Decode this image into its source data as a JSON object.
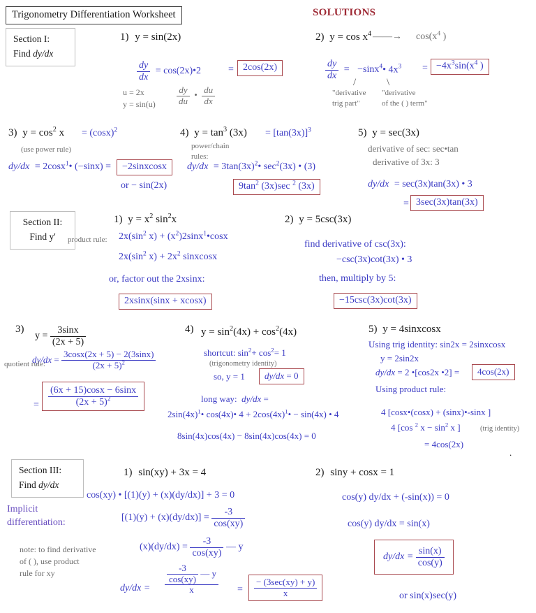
{
  "document": {
    "title": "Trigonometry Differentiation Worksheet",
    "solutions_label": "SOLUTIONS",
    "colors": {
      "work_blue": "#3b3bc4",
      "annotation_gray": "#6e6e6e",
      "answer_box_border": "#a9494f",
      "solutions_red": "#9e2a35",
      "implicit_violet": "#6a4fc0",
      "title_border": "#3a3a3a",
      "section_border": "#bdbdbd"
    }
  },
  "sections": [
    {
      "id": "section-1",
      "box_line1": "Section I:",
      "box_line2_prefix": "Find ",
      "box_line2_math": "dy/dx",
      "problems": [
        {
          "number": "1)",
          "statement": "y = sin(2x)",
          "work": "= cos(2x)•2",
          "deriv_num": "dy",
          "deriv_den": "dx",
          "equals": "=",
          "answer": "2cos(2x)",
          "notes": [
            "u = 2x",
            "y = sin(u)"
          ],
          "chain_num1": "dy",
          "chain_den1": "du",
          "chain_dot": "•",
          "chain_num2": "du",
          "chain_den2": "dx"
        },
        {
          "number": "2)",
          "statement_a": "y = cos x",
          "statement_a_exp": "4",
          "arrow": "——→",
          "statement_b": "cos(x",
          "statement_b_exp": "4",
          "statement_b_close": " )",
          "deriv_num": "dy",
          "deriv_den": "dx",
          "work_a": "−sinx",
          "work_a_exp": "4",
          "work_dot": "• 4x",
          "work_b_exp": "3",
          "equals": "=",
          "answer_a": "−4x",
          "answer_a_exp": "3",
          "answer_b": "sin(x",
          "answer_b_exp": "4",
          "answer_close": " )",
          "note_left_l1": "\"derivative",
          "note_left_l2": "trig part\"",
          "note_right_l1": "\"derivative",
          "note_right_l2": "of the ( ) term\""
        },
        {
          "number": "3)",
          "statement_a": "y = cos",
          "statement_a_exp": "2",
          "statement_a_rest": " x",
          "statement_b": "= (cosx)",
          "statement_b_exp": "2",
          "hint": "(use power rule)",
          "lhs": "dy/dx",
          "work_a": "= 2cosx",
          "work_a_exp": "1",
          "work_b": "• (−sinx)  =",
          "answer": "−2sinxcosx",
          "alt": "or − sin(2x)"
        },
        {
          "number": "4)",
          "statement_a": "y = tan",
          "statement_a_exp": "3",
          "statement_a_rest": " (3x)",
          "statement_b": "=  [tan(3x)]",
          "statement_b_exp": "3",
          "hint_l1": "power/chain",
          "hint_l2": "rules:",
          "lhs": "dy/dx",
          "work_a": "=  3tan(3x)",
          "work_a_exp": "2",
          "work_b": "•  sec",
          "work_b_exp": "2",
          "work_c": "(3x) • (3)",
          "answer_a": "9tan",
          "answer_a_exp": "2",
          "answer_b": " (3x)sec ",
          "answer_b_exp": "2",
          "answer_c": " (3x)"
        },
        {
          "number": "5)",
          "statement": "y = sec(3x)",
          "note1": "derivative of sec:  sec•tan",
          "note2": "derivative of 3x:  3",
          "lhs": "dy/dx",
          "work": "= sec(3x)tan(3x) • 3",
          "equals": "=",
          "answer": "3sec(3x)tan(3x)"
        }
      ]
    },
    {
      "id": "section-2",
      "box_line1": "Section II:",
      "box_line2": "Find y'",
      "problems": [
        {
          "number": "1)",
          "statement_a": "y =   x",
          "statement_a_exp": "2",
          "statement_b": " sin",
          "statement_b_exp": "2",
          "statement_c": "x",
          "rule_label": "product rule:",
          "line1_a": "2x(sin",
          "line1_a_exp": "2",
          "line1_b": " x) + (x",
          "line1_b_exp": "2",
          "line1_c": ")2sinx",
          "line1_c_exp": "1",
          "line1_d": "•cosx",
          "line2_a": "2x(sin",
          "line2_a_exp": "2",
          "line2_b": " x) + 2x",
          "line2_b_exp": "2",
          "line2_c": " sinxcosx",
          "line3": "or,   factor out the 2xsinx:",
          "answer": "2xsinx(sinx + xcosx)"
        },
        {
          "number": "2)",
          "statement": "y = 5csc(3x)",
          "line1": "find derivative of csc(3x):",
          "line2": "−csc(3x)cot(3x) • 3",
          "line3": "then, multiply by 5:",
          "answer": "−15csc(3x)cot(3x)"
        },
        {
          "number": "3)",
          "statement_lhs": "y =",
          "statement_num": "3sinx",
          "statement_den": "(2x + 5)",
          "lhs": "dy/dx",
          "equals": "=",
          "work_num": "3cosx(2x + 5) − 2(3sinx)",
          "work_den_a": "(2x + 5)",
          "work_den_exp": "2",
          "rule_label": "quotient rule:",
          "ans_eq": "=",
          "answer_num": "(6x + 15)cosx − 6sinx",
          "answer_den_a": "(2x + 5)",
          "answer_den_exp": "2"
        },
        {
          "number": "4)",
          "statement_a": "y =  sin",
          "statement_a_exp": "2",
          "statement_b": "(4x) + cos",
          "statement_b_exp": "2",
          "statement_c": "(4x)",
          "shortcut_a": "shortcut:  sin",
          "shortcut_a_exp": "2",
          "shortcut_b": "+ cos",
          "shortcut_b_exp": "2",
          "shortcut_c": "= 1",
          "identity_note": "(trigonometry identity)",
          "so_label": "so, y = 1",
          "answer": "dy/dx = 0",
          "longway_label": "long way:  dy/dx =",
          "long1_a": "2sin(4x)",
          "long1_a_exp": "1",
          "long1_b": "• cos(4x)• 4  +  2cos(4x)",
          "long1_b_exp": "1",
          "long1_c": "• − sin(4x) • 4",
          "long2": "8sin(4x)cos(4x) − 8sin(4x)cos(4x) = 0"
        },
        {
          "number": "5)",
          "statement": "y = 4sinxcosx",
          "line1": "Using trig identity:  sin2x = 2sinxcosx",
          "line2": "y = 2sin2x",
          "line3_lhs": "dy/dx",
          "line3_work": "=  2 •[cos2x •2] =",
          "answer": "4cos(2x)",
          "line4": "Using product rule:",
          "line5": "4 [cosx•(cosx) + (sinx)•-sinx ]",
          "line6_a": "4 [cos ",
          "line6_a_exp": "2",
          "line6_b": " x − sin",
          "line6_b_exp": "2",
          "line6_c": " x ]",
          "line6_note": "(trig identity)",
          "line7": "= 4cos(2x)"
        }
      ]
    },
    {
      "id": "section-3",
      "box_line1": "Section III:",
      "box_line2_prefix": "Find ",
      "box_line2_math": "dy/dx",
      "side_note_l1": "Implicit",
      "side_note_l2": "differentiation:",
      "side_note_small_l1": "note: to find derivative",
      "side_note_small_l2": "of ( ), use product",
      "side_note_small_l3": "rule for xy",
      "problems": [
        {
          "number": "1)",
          "statement": "sin(xy) + 3x = 4",
          "line1": "cos(xy) • [(1)(y) + (x)(dy/dx)] + 3 = 0",
          "line2_lhs": "[(1)(y) + (x)(dy/dx)] =",
          "line2_num": "-3",
          "line2_den": "cos(xy)",
          "line3_lhs": "(x)(dy/dx)  =",
          "line3_num": "-3",
          "line3_den": "cos(xy)",
          "line3_tail": "—  y",
          "line4_lhs": "dy/dx =",
          "line4_num_top": "-3",
          "line4_num_bot": "cos(xy)",
          "line4_num_tail": "—  y",
          "line4_den": "x",
          "line4_eq": "=",
          "answer_num": "− (3sec(xy) + y)",
          "answer_den": "x"
        },
        {
          "number": "2)",
          "statement": "siny + cosx = 1",
          "line1": "cos(y) dy/dx + (-sin(x)) = 0",
          "line2": "cos(y) dy/dx = sin(x)",
          "answer_lhs": "dy/dx =",
          "answer_num": "sin(x)",
          "answer_den": "cos(y)",
          "alt": "or  sin(x)sec(y)"
        }
      ]
    }
  ]
}
